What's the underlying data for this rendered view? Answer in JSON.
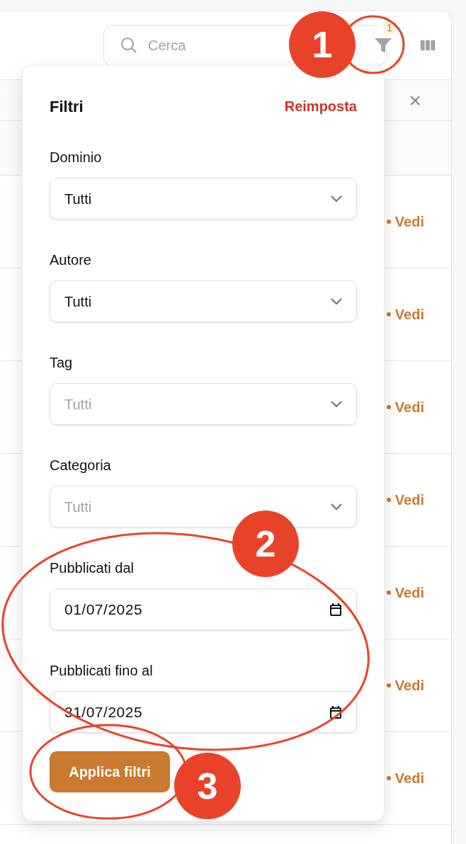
{
  "toolbar": {
    "search": {
      "placeholder": "Cerca"
    },
    "filter_count": "1"
  },
  "table": {
    "close": "×",
    "rows": [
      {
        "action": "Vedi"
      },
      {
        "action": "Vedi"
      },
      {
        "action": "Vedi"
      },
      {
        "action": "Vedi"
      },
      {
        "action": "Vedi"
      },
      {
        "action": "Vedi"
      },
      {
        "action": "Vedi"
      }
    ]
  },
  "filter_panel": {
    "title": "Filtri",
    "reset": "Reimposta",
    "fields": [
      {
        "label": "Dominio",
        "kind": "select",
        "value": "Tutti"
      },
      {
        "label": "Autore",
        "kind": "select",
        "value": "Tutti"
      },
      {
        "label": "Tag",
        "kind": "select",
        "placeholder": "Tutti"
      },
      {
        "label": "Categoria",
        "kind": "select",
        "placeholder": "Tutti"
      },
      {
        "label": "Pubblicati dal",
        "kind": "date",
        "value": "01/07/2025"
      },
      {
        "label": "Pubblicati fino al",
        "kind": "date",
        "value": "31/07/2025"
      }
    ],
    "apply": "Applica filtri"
  },
  "annotations": [
    {
      "number": "1"
    },
    {
      "number": "2"
    },
    {
      "number": "3"
    }
  ]
}
